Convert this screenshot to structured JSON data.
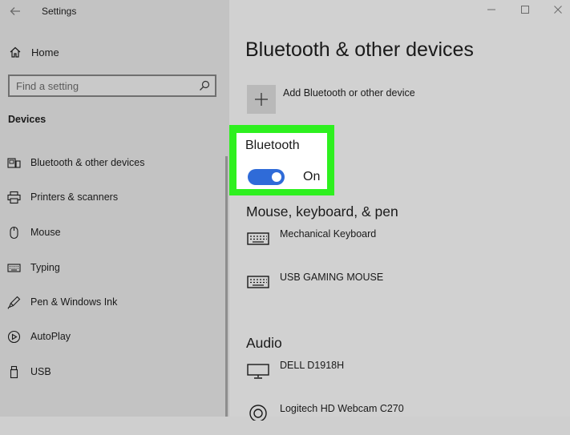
{
  "window": {
    "title": "Settings"
  },
  "sidebar": {
    "home_label": "Home",
    "search_placeholder": "Find a setting",
    "section_label": "Devices",
    "items": [
      {
        "label": "Bluetooth & other devices",
        "icon": "bluetooth-devices-icon",
        "active": true
      },
      {
        "label": "Printers & scanners",
        "icon": "printer-icon",
        "active": false
      },
      {
        "label": "Mouse",
        "icon": "mouse-icon",
        "active": false
      },
      {
        "label": "Typing",
        "icon": "keyboard-icon",
        "active": false
      },
      {
        "label": "Pen & Windows Ink",
        "icon": "pen-icon",
        "active": false
      },
      {
        "label": "AutoPlay",
        "icon": "autoplay-icon",
        "active": false
      },
      {
        "label": "USB",
        "icon": "usb-icon",
        "active": false
      }
    ]
  },
  "main": {
    "title": "Bluetooth & other devices",
    "add_device_label": "Add Bluetooth or other device",
    "bluetooth": {
      "heading": "Bluetooth",
      "state": "On",
      "enabled": true
    },
    "groups": [
      {
        "title": "Mouse, keyboard, & pen",
        "devices": [
          {
            "name": "Mechanical Keyboard",
            "icon": "keyboard-icon"
          },
          {
            "name": "USB GAMING MOUSE",
            "icon": "keyboard-icon"
          }
        ]
      },
      {
        "title": "Audio",
        "devices": [
          {
            "name": "DELL D1918H",
            "icon": "monitor-icon"
          },
          {
            "name": "Logitech HD Webcam C270",
            "icon": "webcam-icon"
          }
        ]
      }
    ]
  },
  "colors": {
    "sidebar_bg": "#c3c3c3",
    "content_bg": "#d1d1d1",
    "highlight": "#2ef01f",
    "toggle_on": "#2f6bd8"
  }
}
